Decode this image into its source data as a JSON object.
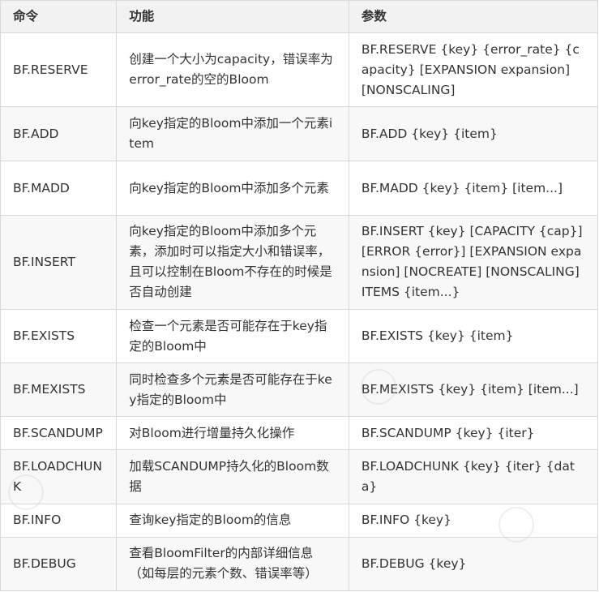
{
  "table": {
    "headers": {
      "command": "命令",
      "function": "功能",
      "params": "参数"
    },
    "rows": [
      {
        "command": "BF.RESERVE",
        "function": "创建一个大小为capacity，错误率为error_rate的空的Bloom",
        "params": "BF.RESERVE {key} {error_rate} {capacity} [EXPANSION expansion] [NONSCALING]"
      },
      {
        "command": "BF.ADD",
        "function": "向key指定的Bloom中添加一个元素item",
        "params": "BF.ADD {key} {item}"
      },
      {
        "command": "BF.MADD",
        "function": "向key指定的Bloom中添加多个元素",
        "params": "BF.MADD {key} {item} [item...]"
      },
      {
        "command": "BF.INSERT",
        "function": "向key指定的Bloom中添加多个元素，添加时可以指定大小和错误率，且可以控制在Bloom不存在的时候是否自动创建",
        "params": "BF.INSERT {key} [CAPACITY {cap}] [ERROR {error}] [EXPANSION expansion] [NOCREATE] [NONSCALING] ITEMS {item...}"
      },
      {
        "command": "BF.EXISTS",
        "function": "检查一个元素是否可能存在于key指定的Bloom中",
        "params": "BF.EXISTS {key} {item}"
      },
      {
        "command": "BF.MEXISTS",
        "function": "同时检查多个元素是否可能存在于key指定的Bloom中",
        "params": "BF.MEXISTS {key} {item} [item...]"
      },
      {
        "command": "BF.SCANDUMP",
        "function": "对Bloom进行增量持久化操作",
        "params": "BF.SCANDUMP {key} {iter}"
      },
      {
        "command": "BF.LOADCHUNK",
        "function": "加载SCANDUMP持久化的Bloom数据",
        "params": "BF.LOADCHUNK {key} {iter} {data}"
      },
      {
        "command": "BF.INFO",
        "function": "查询key指定的Bloom的信息",
        "params": "BF.INFO {key}"
      },
      {
        "command": "BF.DEBUG",
        "function": "查看BloomFilter的内部详细信息（如每层的元素个数、错误率等）",
        "params": "BF.DEBUG {key}"
      }
    ]
  }
}
